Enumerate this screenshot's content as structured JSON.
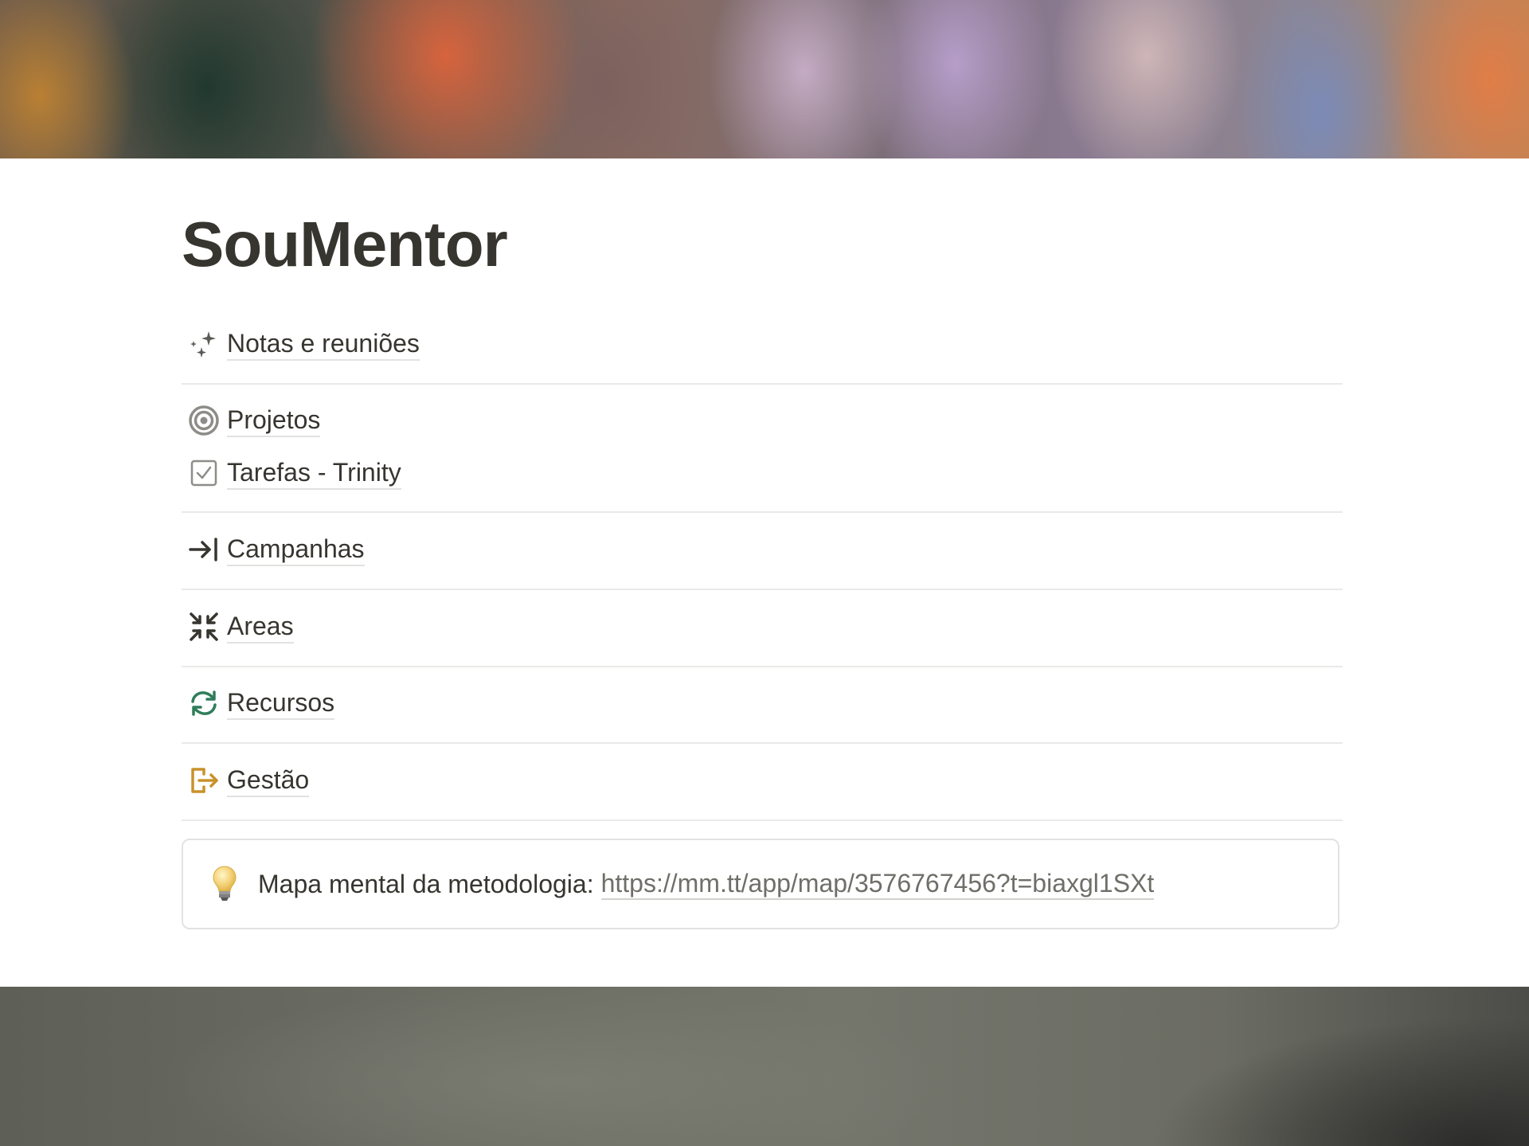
{
  "page": {
    "title": "SouMentor"
  },
  "items": [
    {
      "label": "Notas e reuniões",
      "icon": "sparkles-icon"
    },
    {
      "label": "Projetos",
      "icon": "target-icon"
    },
    {
      "label": "Tarefas - Trinity",
      "icon": "checkbox-icon"
    },
    {
      "label": "Campanhas",
      "icon": "arrow-to-line-icon"
    },
    {
      "label": "Areas",
      "icon": "arrows-inward-icon"
    },
    {
      "label": "Recursos",
      "icon": "refresh-icon",
      "color": "#2f7d5a"
    },
    {
      "label": "Gestão",
      "icon": "exit-icon",
      "color": "#c8922b"
    }
  ],
  "callout": {
    "icon": "lightbulb-icon",
    "text": "Mapa mental da metodologia:",
    "link": "https://mm.tt/app/map/3576767456?t=biaxgl1SXt"
  }
}
